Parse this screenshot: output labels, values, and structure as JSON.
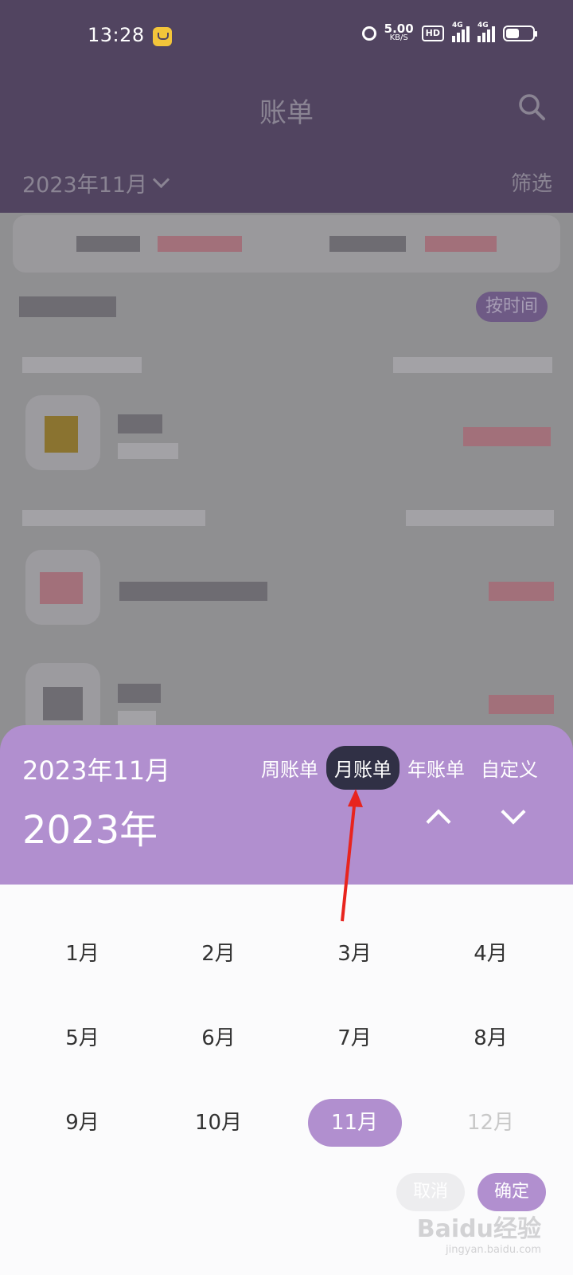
{
  "status_bar": {
    "time": "13:28",
    "speed_value": "5.00",
    "speed_unit": "KB/S",
    "hd": "HD",
    "network1": "4G",
    "network2": "4G"
  },
  "header": {
    "title": "账单",
    "month": "2023年11月",
    "filter": "筛选"
  },
  "list": {
    "sort_label": "按时间"
  },
  "sheet": {
    "period": "2023年11月",
    "year": "2023年",
    "tabs": [
      "周账单",
      "月账单",
      "年账单",
      "自定义"
    ],
    "active_tab": "月账单",
    "months": [
      "1月",
      "2月",
      "3月",
      "4月",
      "5月",
      "6月",
      "7月",
      "8月",
      "9月",
      "10月",
      "11月",
      "12月"
    ],
    "selected_month": "11月",
    "disabled_month": "12月",
    "cancel": "取消",
    "confirm": "确定"
  },
  "colors": {
    "header_bg": "#514460",
    "accent": "#b18fcf",
    "active_tab": "#303045",
    "annotation_arrow": "#e8241e"
  },
  "watermark": {
    "brand": "Baidu经验",
    "url": "jingyan.baidu.com"
  }
}
